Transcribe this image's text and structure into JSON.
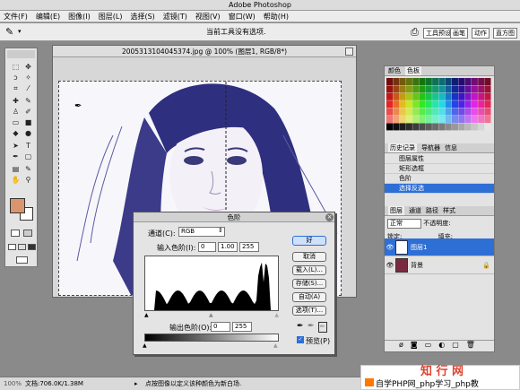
{
  "app_title": "Adobe Photoshop",
  "menu": [
    "文件(F)",
    "编辑(E)",
    "图像(I)",
    "图层(L)",
    "选择(S)",
    "滤镜(T)",
    "视图(V)",
    "窗口(W)",
    "帮助(H)"
  ],
  "options": {
    "hint": "当前工具没有选项.",
    "tabs": [
      "工具预设",
      "画笔",
      "动作",
      "直方图"
    ]
  },
  "document": {
    "title": "2005313104045374.jpg @ 100% (图层1, RGB/8*)"
  },
  "palette": {
    "swatch_tabs": [
      "颜色",
      "色板"
    ],
    "history_tabs": [
      "历史记录",
      "导航器",
      "信息"
    ],
    "history_items": [
      "图层属性",
      "矩形选框",
      "色阶",
      "选择反选"
    ],
    "layer_tabs": [
      "图层",
      "通道",
      "路径",
      "样式"
    ],
    "blend": "正常",
    "opacity_label": "不透明度:",
    "lock_label": "锁定:",
    "fill_label": "填充:",
    "layers": [
      {
        "name": "图层1"
      },
      {
        "name": "背景"
      }
    ]
  },
  "levels": {
    "title": "色阶",
    "channel_label": "通道(C):",
    "channel_value": "RGB",
    "input_label": "输入色阶(I):",
    "input_values": [
      "0",
      "1.00",
      "255"
    ],
    "output_label": "输出色阶(O):",
    "output_values": [
      "0",
      "255"
    ],
    "buttons": [
      "好",
      "取消",
      "载入(L)...",
      "存储(S)...",
      "自动(A)",
      "选项(T)..."
    ],
    "preview_label": "预览(P)"
  },
  "status": {
    "zoom": "100%",
    "doc_size": "文档:706.0K/1.38M",
    "hint": "点按图像以定义该种颜色为新白场."
  },
  "watermark": {
    "logo": "知 行 网",
    "text": "自学PHP网_php学习_php教"
  },
  "colors": {
    "foreground": "#d9956e",
    "highlight": "#2e6fd6"
  }
}
